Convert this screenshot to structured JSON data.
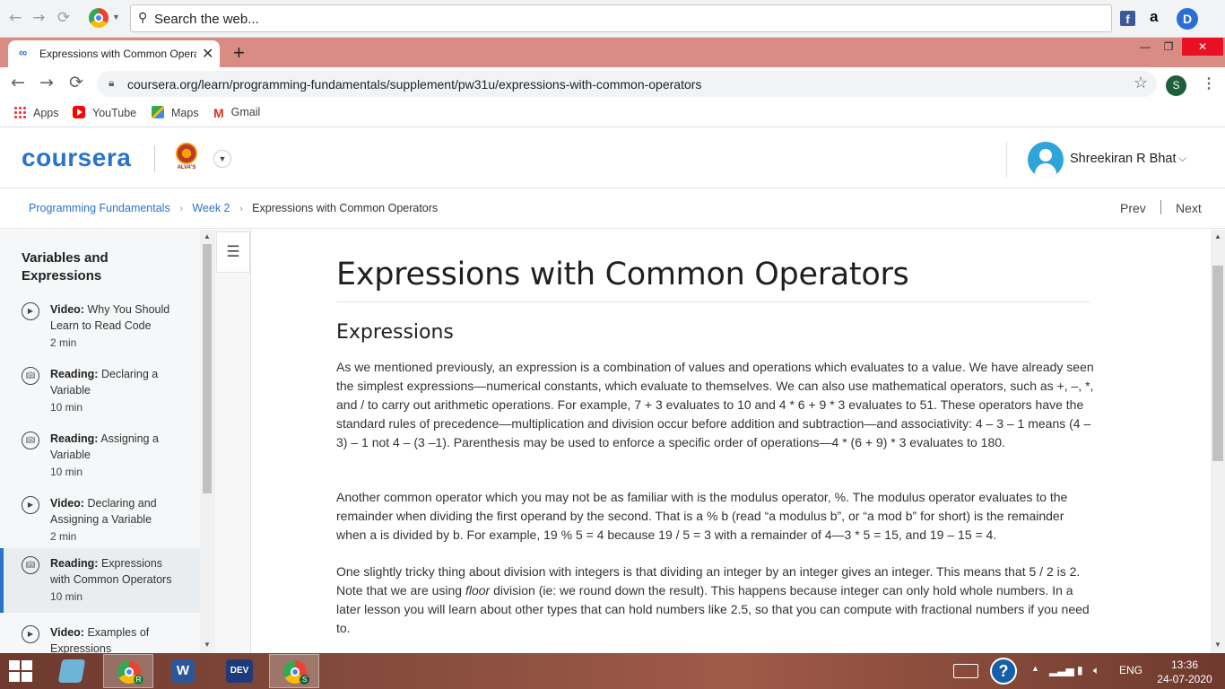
{
  "topbar": {
    "search_placeholder": "Search the web...",
    "icons": [
      "back-icon",
      "forward-icon",
      "reload-icon",
      "chrome-icon",
      "search-icon",
      "facebook-icon",
      "amazon-icon",
      "dashlane-icon"
    ],
    "fb_label": "f",
    "amazon_label": "a",
    "d_label": "D"
  },
  "tabstrip": {
    "active_tab_title": "Expressions with Common Operators | Coursera",
    "close_glyph": "✕",
    "new_tab_glyph": "+",
    "minimize": "—",
    "restore": "❐",
    "close": "✕"
  },
  "addressbar": {
    "url": "coursera.org/learn/programming-fundamentals/supplement/pw31u/expressions-with-common-operators",
    "profile_initial": "S"
  },
  "bookmarks": [
    {
      "label": "Apps",
      "icon": "apps-grid-icon"
    },
    {
      "label": "YouTube",
      "icon": "youtube-icon"
    },
    {
      "label": "Maps",
      "icon": "maps-icon"
    },
    {
      "label": "Gmail",
      "icon": "gmail-icon"
    }
  ],
  "header": {
    "logo": "coursera",
    "institution_label": "ALVA'S",
    "user_name": "Shreekiran R Bhat"
  },
  "breadcrumb": {
    "items": [
      "Programming Fundamentals",
      "Week 2"
    ],
    "current": "Expressions with Common Operators",
    "prev": "Prev",
    "next": "Next"
  },
  "sidebar": {
    "title": "Variables and Expressions",
    "lessons": [
      {
        "type": "Video:",
        "title": "Why You Should Learn to Read Code",
        "duration": "2 min",
        "icon": "play-icon",
        "active": false
      },
      {
        "type": "Reading:",
        "title": "Declaring a Variable",
        "duration": "10 min",
        "icon": "reading-icon",
        "active": false
      },
      {
        "type": "Reading:",
        "title": "Assigning a Variable",
        "duration": "10 min",
        "icon": "reading-icon",
        "active": false
      },
      {
        "type": "Video:",
        "title": "Declaring and Assigning a Variable",
        "duration": "2 min",
        "icon": "play-icon",
        "active": false
      },
      {
        "type": "Reading:",
        "title": "Expressions with Common Operators",
        "duration": "10 min",
        "icon": "reading-icon",
        "active": true
      },
      {
        "type": "Video:",
        "title": "Examples of Expressions",
        "duration": "",
        "icon": "play-icon",
        "active": false
      }
    ]
  },
  "main": {
    "title": "Expressions with Common Operators",
    "section": "Expressions",
    "paragraph1": "As we mentioned previously, an expression is a combination of values and operations which evaluates to a value. We have already seen the simplest expressions—numerical constants, which evaluate to themselves. We can also use mathematical operators, such as +, –, *, and / to carry out arithmetic operations. For example, 7 + 3 evaluates to 10 and 4 * 6 + 9 * 3 evaluates to 51. These operators have the standard rules of precedence—multiplication and division occur before addition and subtraction—and associativity: 4 – 3 – 1 means (4 – 3) – 1 not 4 – (3 –1). Parenthesis may be used to enforce a specific order of operations—4 * (6 + 9) * 3 evaluates to 180.",
    "paragraph2": "Another common operator which you may not be as familiar with is the modulus operator, %. The modulus operator evaluates to the remainder when dividing the first operand by the second. That is a % b (read “a modulus b”, or “a mod b” for short) is the remainder when a is divided by b. For example, 19 % 5 = 4 because 19 / 5 = 3 with a remainder of 4—3 * 5 = 15, and 19 – 15 = 4.",
    "paragraph3_a": "One slightly tricky thing about division with integers is that dividing an integer by an integer gives an integer. This means that 5 / 2 is 2. Note that we are using ",
    "paragraph3_em": "floor",
    "paragraph3_b": " division (ie: we round down the result). This happens because integer can only hold whole numbers. In a later lesson you will learn about other types that can hold numbers like 2.5, so that you can compute with fractional numbers if you need to."
  },
  "taskbar": {
    "apps": [
      "windows-start-icon",
      "notepad-icon",
      "chrome-icon",
      "word-icon",
      "devcpp-icon",
      "chrome-icon"
    ],
    "chrome_badge_1": "R",
    "chrome_badge_2": "S",
    "word_label": "W",
    "dev_label": "DEV",
    "language": "ENG",
    "time": "13:36",
    "date": "24-07-2020"
  }
}
